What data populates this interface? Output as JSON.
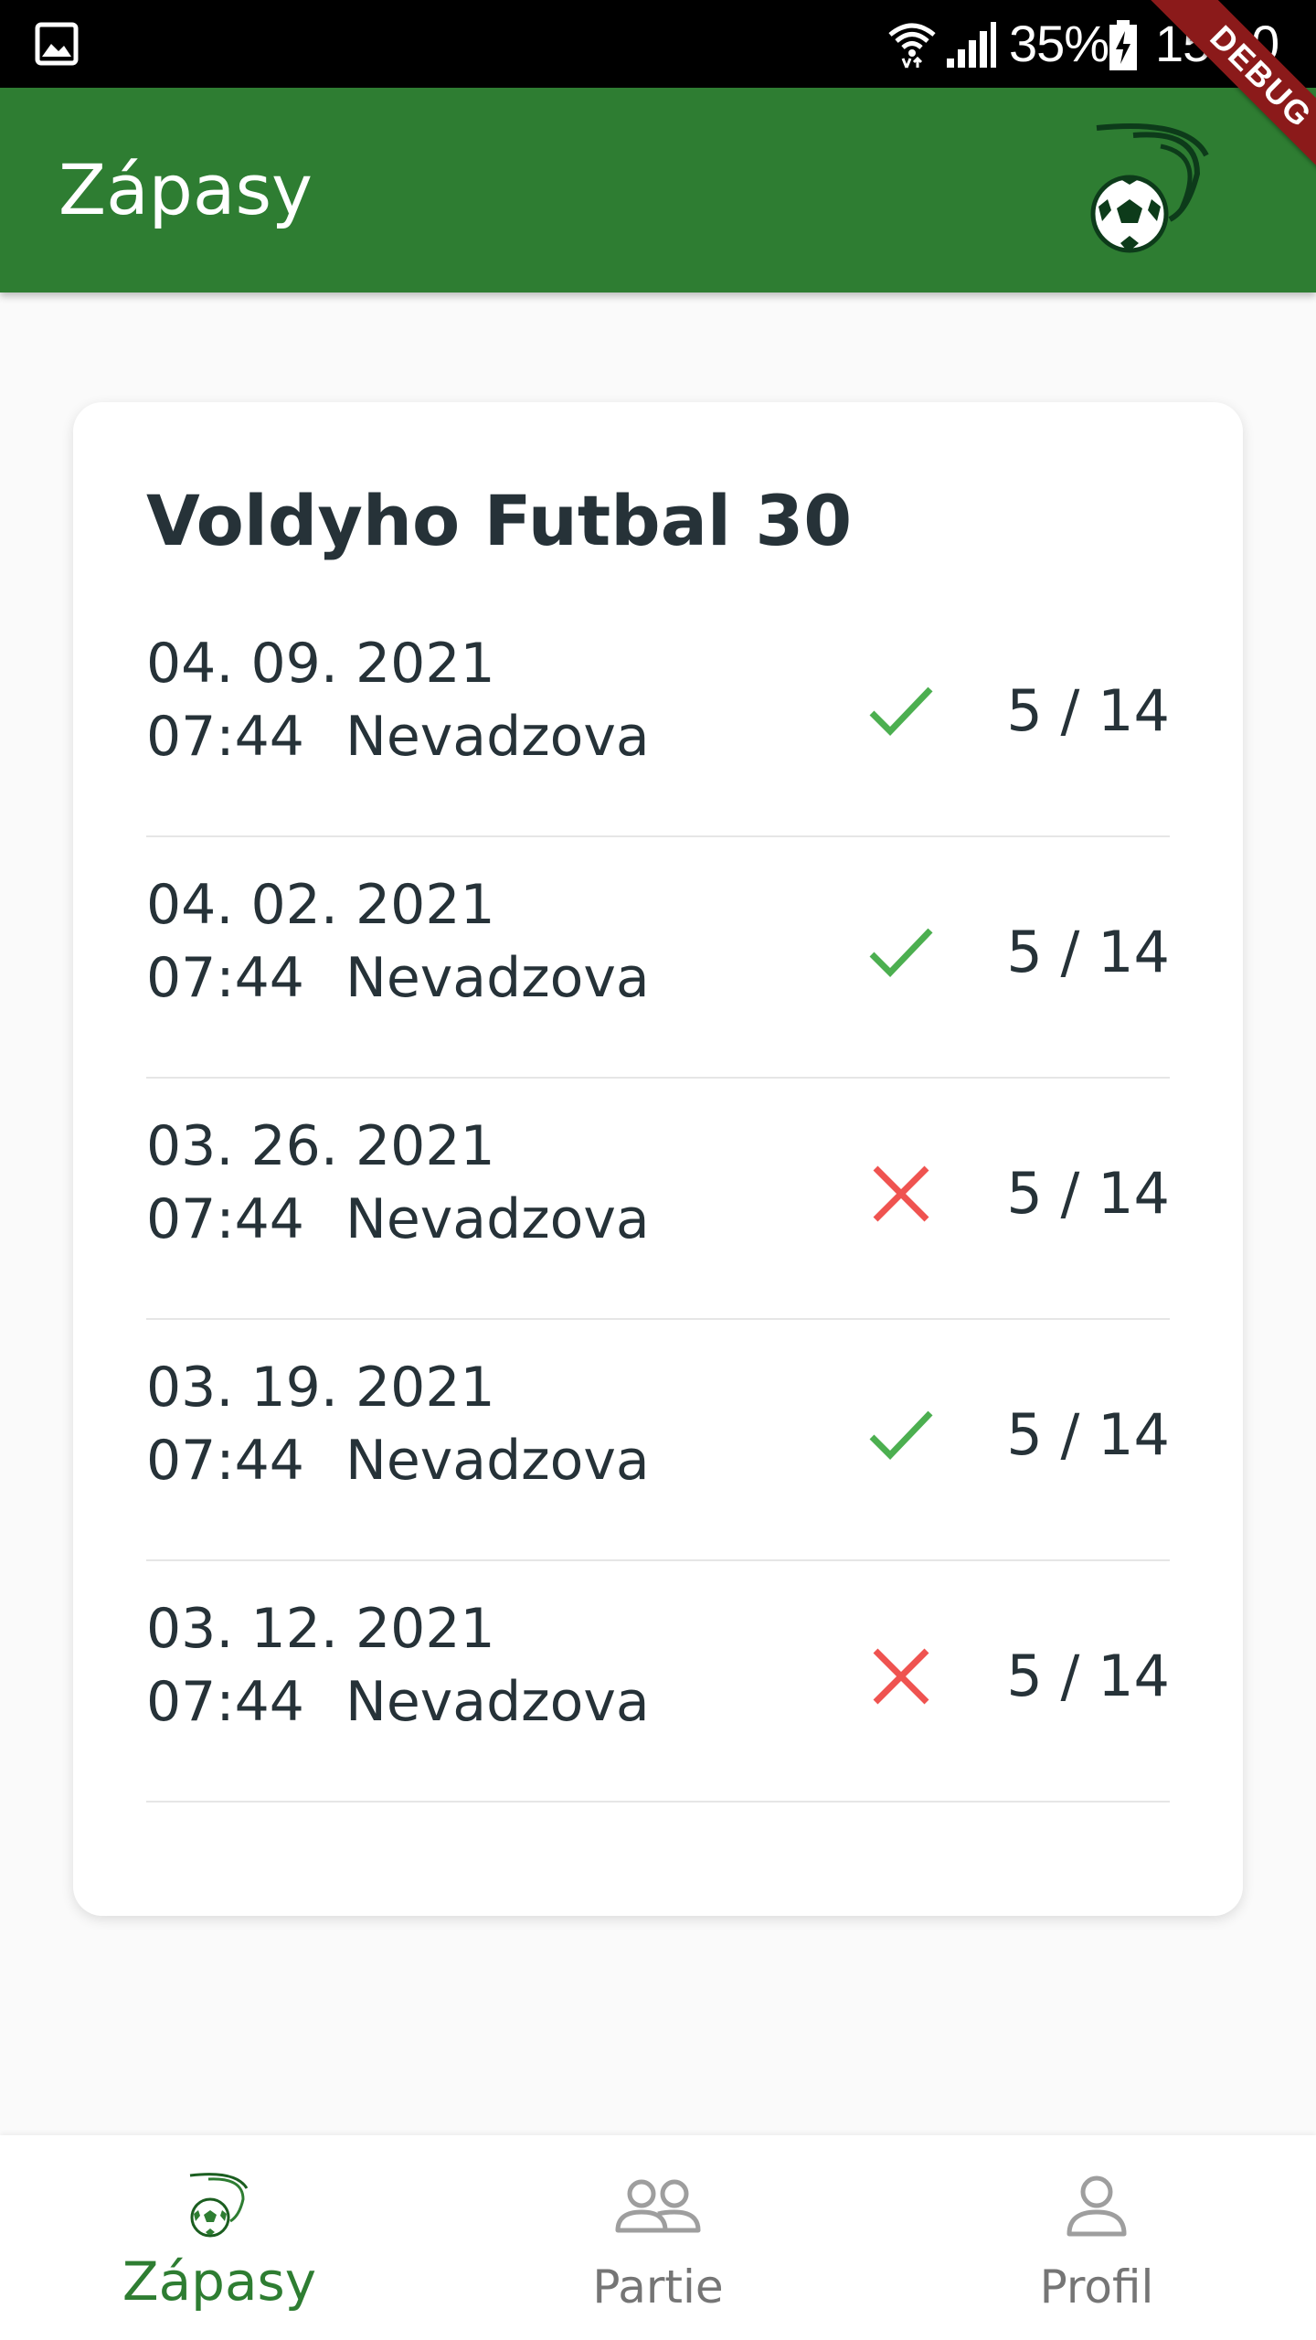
{
  "status_bar": {
    "battery": "35%",
    "time": "15:10",
    "icons": [
      "gallery-icon",
      "wifi-icon",
      "signal-icon",
      "battery-charging-icon"
    ]
  },
  "app_bar": {
    "title": "Zápasy",
    "logo_icon": "soccer-ball-logo-icon",
    "debug_banner": "DEBUG"
  },
  "colors": {
    "primary": "#2e7d32",
    "check": "#4caf50",
    "cross": "#ef5350",
    "text": "#263238"
  },
  "card": {
    "title": "Voldyho Futbal 30",
    "matches": [
      {
        "date": "04. 09. 2021",
        "time": "07:44",
        "location": "Nevadzova",
        "status": "check",
        "count": "5 / 14"
      },
      {
        "date": "04. 02. 2021",
        "time": "07:44",
        "location": "Nevadzova",
        "status": "check",
        "count": "5 / 14"
      },
      {
        "date": "03. 26. 2021",
        "time": "07:44",
        "location": "Nevadzova",
        "status": "cross",
        "count": "5 / 14"
      },
      {
        "date": "03. 19. 2021",
        "time": "07:44",
        "location": "Nevadzova",
        "status": "check",
        "count": "5 / 14"
      },
      {
        "date": "03. 12. 2021",
        "time": "07:44",
        "location": "Nevadzova",
        "status": "cross",
        "count": "5 / 14"
      }
    ]
  },
  "bottom_nav": {
    "items": [
      {
        "label": "Zápasy",
        "icon": "soccer-ball-icon",
        "active": true
      },
      {
        "label": "Partie",
        "icon": "people-icon",
        "active": false
      },
      {
        "label": "Profil",
        "icon": "person-icon",
        "active": false
      }
    ]
  }
}
